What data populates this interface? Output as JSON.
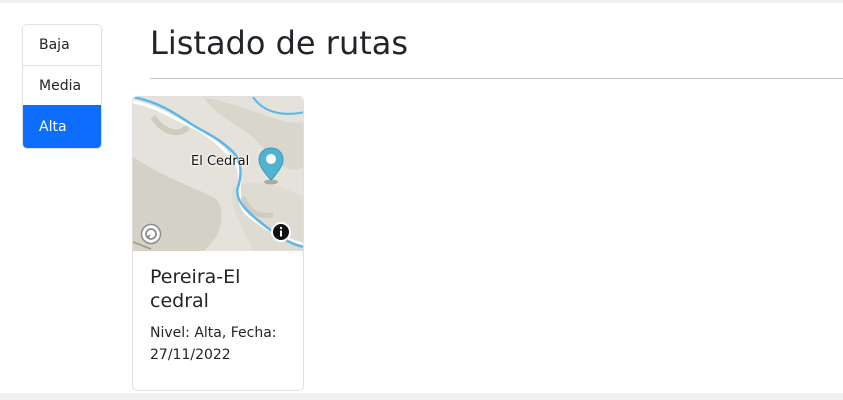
{
  "levels": {
    "items": [
      {
        "label": "Baja",
        "active": false
      },
      {
        "label": "Media",
        "active": false
      },
      {
        "label": "Alta",
        "active": true
      }
    ]
  },
  "header": {
    "title": "Listado de rutas"
  },
  "routes": [
    {
      "name": "Pereira-El cedral",
      "description": "Nivel: Alta, Fecha: 27/11/2022",
      "map": {
        "place_label": "El Cedral",
        "marker_icon": "map-pin-icon",
        "attribution_icon": "info-icon"
      }
    }
  ],
  "colors": {
    "active": "#0d6efd",
    "marker": "#4fb3d1",
    "river": "#5bb8e8"
  }
}
